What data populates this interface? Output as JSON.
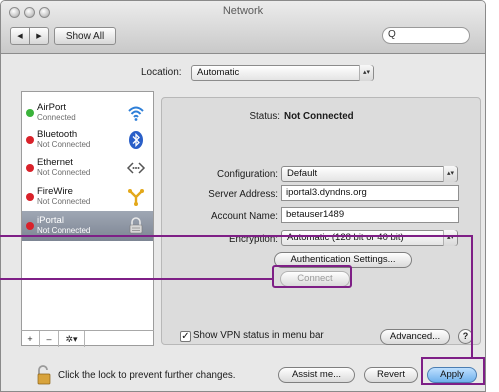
{
  "window": {
    "title": "Network",
    "show_all_label": "Show All",
    "nav_back_glyph": "◀",
    "nav_forward_glyph": "▶",
    "search_placeholder": "Q",
    "search_icon": "magnifier-icon"
  },
  "location": {
    "label": "Location:",
    "value": "Automatic"
  },
  "services": [
    {
      "name": "AirPort",
      "status": "Connected",
      "dot_color": "#3bb33b",
      "icon": "wifi-icon"
    },
    {
      "name": "Bluetooth",
      "status": "Not Connected",
      "dot_color": "#d9222a",
      "icon": "bluetooth-icon"
    },
    {
      "name": "Ethernet",
      "status": "Not Connected",
      "dot_color": "#d9222a",
      "icon": "ethernet-icon"
    },
    {
      "name": "FireWire",
      "status": "Not Connected",
      "dot_color": "#d9222a",
      "icon": "firewire-icon"
    },
    {
      "name": "iPortal",
      "status": "Not Connected",
      "dot_color": "#d9222a",
      "icon": "vpn-lock-icon",
      "selected": true
    }
  ],
  "sidebar_tools": {
    "add": "+",
    "remove": "–",
    "action": "✲▾"
  },
  "detail": {
    "status_label": "Status:",
    "status_value": "Not Connected",
    "configuration_label": "Configuration:",
    "configuration_value": "Default",
    "server_label": "Server Address:",
    "server_value": "iportal3.dyndns.org",
    "account_label": "Account Name:",
    "account_value": "betauser1489",
    "encryption_label": "Encryption:",
    "encryption_value": "Automatic (128 bit or 40 bit)",
    "auth_button": "Authentication Settings...",
    "connect_button": "Connect",
    "show_vpn_label": "Show VPN status in menu bar",
    "show_vpn_checked": true,
    "check_glyph": "✓",
    "advanced_button": "Advanced...",
    "help_glyph": "?"
  },
  "footer": {
    "lock_text": "Click the lock to prevent further changes.",
    "assist_button": "Assist me...",
    "revert_button": "Revert",
    "apply_button": "Apply"
  },
  "colors": {
    "annotation": "#7e1f86",
    "connected": "#3bb33b",
    "not_connected": "#d9222a",
    "selection": "#8a92a0"
  }
}
